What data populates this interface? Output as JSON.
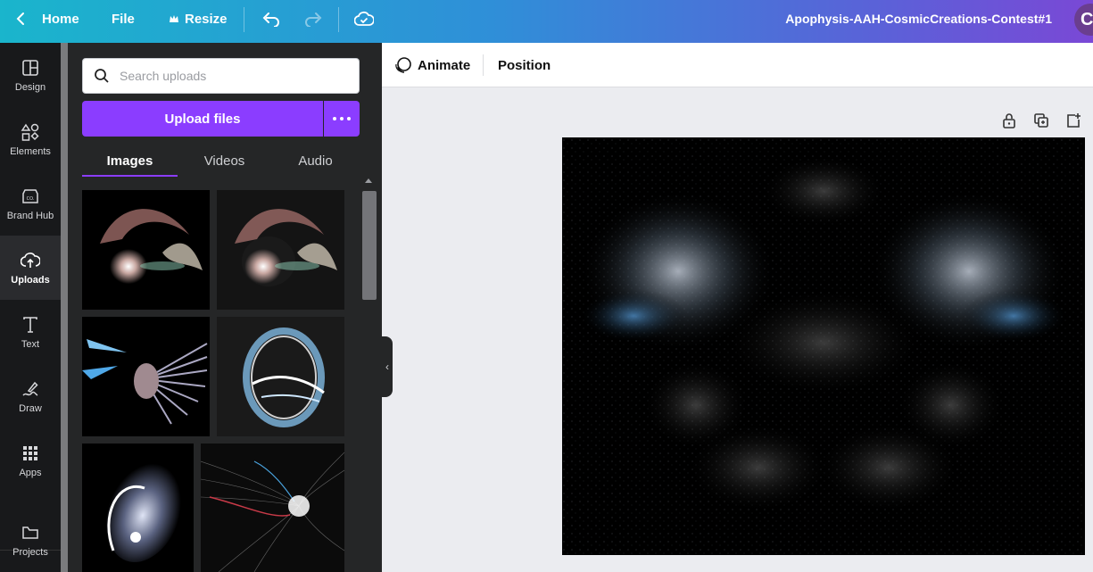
{
  "topbar": {
    "home_label": "Home",
    "file_label": "File",
    "resize_label": "Resize",
    "title": "Apophysis-AAH-CosmicCreations-Contest#1",
    "avatar_initial": "C"
  },
  "rail": {
    "items": [
      {
        "label": "Design",
        "icon": "design-icon"
      },
      {
        "label": "Elements",
        "icon": "elements-icon"
      },
      {
        "label": "Brand Hub",
        "icon": "brand-hub-icon"
      },
      {
        "label": "Uploads",
        "icon": "upload-cloud-icon"
      },
      {
        "label": "Text",
        "icon": "text-icon"
      },
      {
        "label": "Draw",
        "icon": "draw-icon"
      },
      {
        "label": "Apps",
        "icon": "apps-grid-icon"
      },
      {
        "label": "Projects",
        "icon": "folder-icon"
      }
    ]
  },
  "panel": {
    "search_placeholder": "Search uploads",
    "upload_label": "Upload files",
    "tabs": [
      {
        "label": "Images",
        "active": true
      },
      {
        "label": "Videos",
        "active": false
      },
      {
        "label": "Audio",
        "active": false
      }
    ]
  },
  "context_bar": {
    "animate_label": "Animate",
    "position_label": "Position"
  },
  "colors": {
    "accent": "#8b3dff",
    "rail_bg": "#18191b",
    "panel_bg": "#252627",
    "canvas_bg": "#ebecf0"
  }
}
